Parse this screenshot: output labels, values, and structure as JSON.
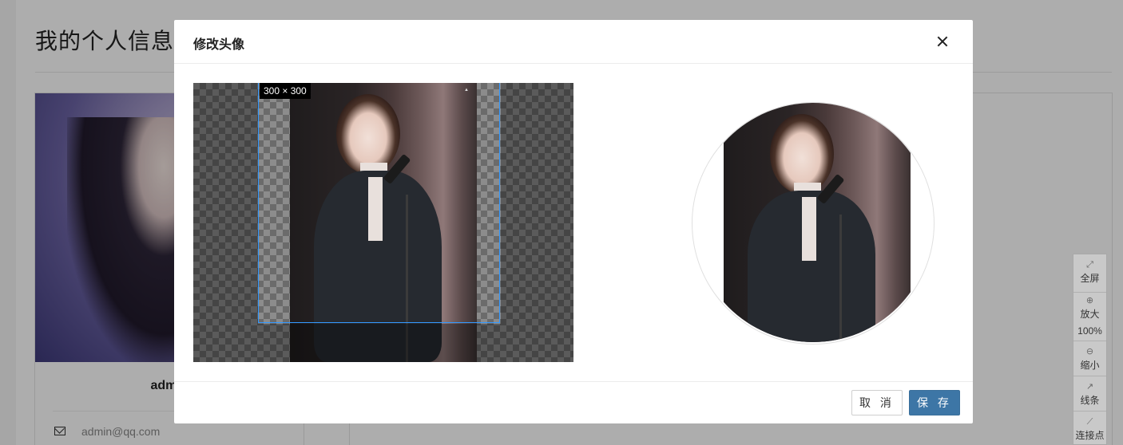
{
  "page": {
    "title": "我的个人信息",
    "profile": {
      "name": "admin",
      "email": "admin@qq.com"
    }
  },
  "side_toolbar": {
    "items": [
      {
        "icon": "fullscreen-icon",
        "label": "全屏"
      },
      {
        "icon": "zoom-in-icon",
        "label": "放大"
      },
      {
        "zoom_level": "100%"
      },
      {
        "icon": "zoom-out-icon",
        "label": "缩小"
      },
      {
        "icon": "line-chart-icon",
        "label": "线条"
      },
      {
        "icon": "connect-point-icon",
        "label": "连接点"
      }
    ]
  },
  "dialog": {
    "title": "修改头像",
    "crop_size": "300 × 300",
    "cancel_label": "取 消",
    "save_label": "保 存"
  },
  "colors": {
    "primary_button": "#3d76a6",
    "crop_border": "#3399ff"
  }
}
